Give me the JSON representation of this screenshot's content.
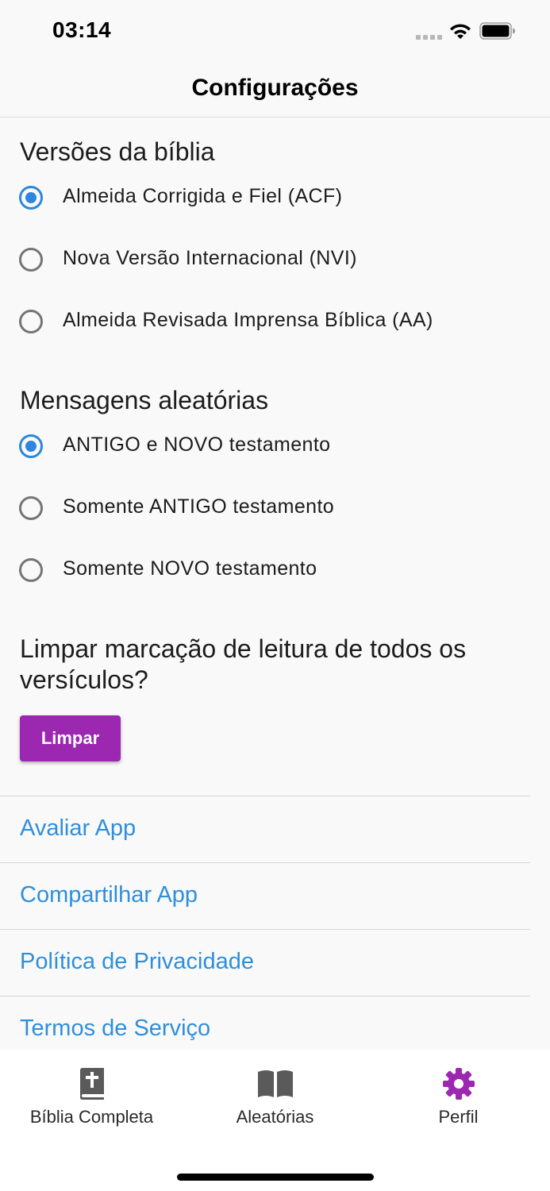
{
  "status_bar": {
    "time": "03:14"
  },
  "nav": {
    "title": "Configurações"
  },
  "bible_versions": {
    "title": "Versões da bíblia",
    "options": [
      {
        "label": "Almeida Corrigida e Fiel (ACF)",
        "selected": true
      },
      {
        "label": "Nova Versão Internacional (NVI)",
        "selected": false
      },
      {
        "label": "Almeida Revisada Imprensa Bíblica (AA)",
        "selected": false
      }
    ]
  },
  "random_messages": {
    "title": "Mensagens aleatórias",
    "options": [
      {
        "label": "ANTIGO e NOVO testamento",
        "selected": true
      },
      {
        "label": "Somente ANTIGO testamento",
        "selected": false
      },
      {
        "label": "Somente NOVO testamento",
        "selected": false
      }
    ]
  },
  "clear_section": {
    "question_line1": "Limpar marcação de leitura de todos os",
    "question_line2": "versículos?",
    "button_label": "Limpar"
  },
  "links": [
    {
      "label": "Avaliar App"
    },
    {
      "label": "Compartilhar App"
    },
    {
      "label": "Política de Privacidade"
    },
    {
      "label": "Termos de Serviço"
    }
  ],
  "tab_bar": {
    "tabs": [
      {
        "label": "Bíblia Completa",
        "icon": "bible-icon",
        "active": false
      },
      {
        "label": "Aleatórias",
        "icon": "open-book-icon",
        "active": false
      },
      {
        "label": "Perfil",
        "icon": "gear-icon",
        "active": true
      }
    ]
  },
  "colors": {
    "accent_blue": "#2f86de",
    "link_blue": "#2f8fdb",
    "button_purple": "#9c27b0",
    "active_tab_purple": "#9c27b0",
    "inactive_tab_icon": "#5a5a5a"
  }
}
